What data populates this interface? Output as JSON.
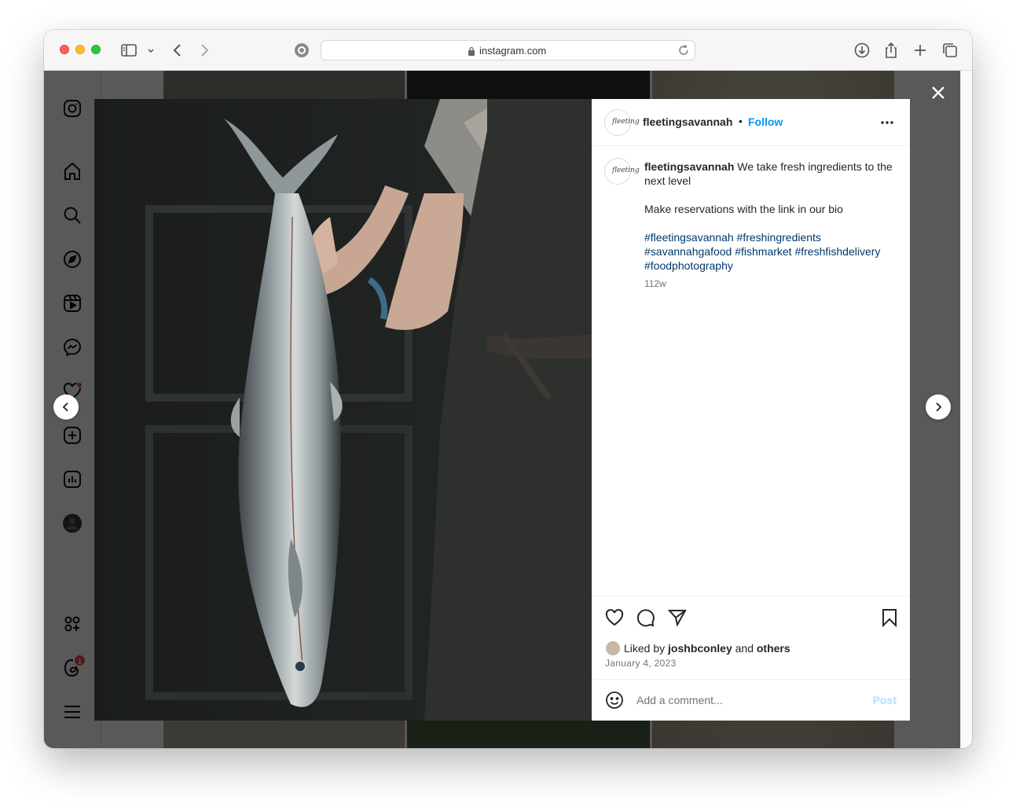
{
  "browser": {
    "url": "instagram.com",
    "icons": [
      "sidebar-icon",
      "chevron-down-icon",
      "back-icon",
      "forward-icon",
      "site-icon",
      "lock-icon",
      "reload-icon",
      "download-icon",
      "share-icon",
      "plus-icon",
      "tabs-icon"
    ]
  },
  "sidebar": {
    "items": [
      "instagram-logo-icon",
      "home-icon",
      "search-icon",
      "explore-icon",
      "reels-icon",
      "messenger-icon",
      "notifications-icon",
      "create-icon",
      "dashboard-icon",
      "profile-icon",
      "also-from-meta-icon",
      "threads-icon",
      "menu-icon"
    ],
    "threads_badge": "1"
  },
  "post": {
    "username": "fleetingsavannah",
    "separator": "•",
    "follow_label": "Follow",
    "avatar_text": "fleeting",
    "caption_text": "We take fresh ingredients to the next level",
    "caption_line2": "Make reservations with the link in our bio",
    "hashtags": "#fleetingsavannah #freshingredients #savannahgafood #fishmarket #freshfishdelivery #foodphotography",
    "age": "112w",
    "liked_prefix": "Liked by",
    "liked_user": "joshbconley",
    "liked_and": "and",
    "liked_others": "others",
    "date": "January 4, 2023",
    "comment_placeholder": "Add a comment...",
    "post_label": "Post"
  },
  "colors": {
    "follow": "#0095f6",
    "hashtag": "#00376b",
    "post_disabled": "#b2dffc",
    "notification_dot": "#ed4956"
  }
}
